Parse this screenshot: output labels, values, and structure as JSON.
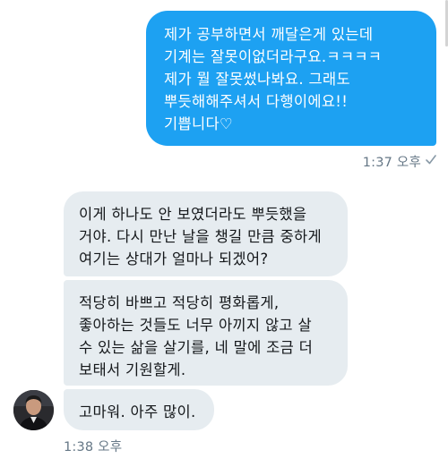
{
  "conversation": {
    "messages": [
      {
        "direction": "sent",
        "text": "제가 공부하면서 깨달은게 있는데\n기계는 잘못이없더라구요.ㅋㅋㅋㅋ\n제가 뭘 잘못썼나봐요. 그래도\n뿌듯해해주셔서 다행이에요!!\n기쁩니다♡"
      },
      {
        "direction": "received",
        "text": "이게 하나도 안 보였더라도 뿌듯했을\n거야. 다시 만난 날을 챙길 만큼 중하게\n여기는 상대가 얼마나 되겠어?"
      },
      {
        "direction": "received",
        "text": "적당히 바쁘고 적당히 평화롭게,\n좋아하는 것들도 너무 아끼지 않고 살\n수 있는 삶을 살기를, 네 말에 조금 더\n보태서 기원할게."
      },
      {
        "direction": "received",
        "text": "고마워. 아주 많이."
      }
    ],
    "sent_timestamp": "1:37 오후",
    "received_timestamp": "1:38 오후",
    "sent_status_icon": "check-icon",
    "avatar_icon": "avatar"
  },
  "colors": {
    "sent_bubble": "#1da1f2",
    "received_bubble": "#e6ecf0",
    "timestamp": "#657786"
  }
}
